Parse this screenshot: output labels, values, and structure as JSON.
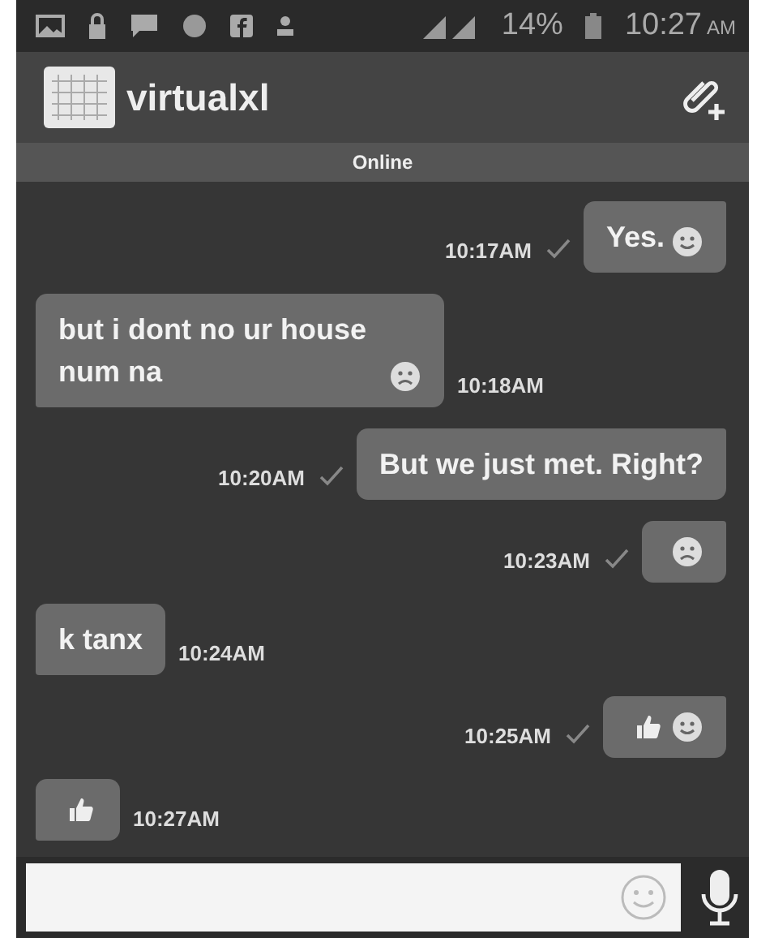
{
  "status_bar": {
    "battery": "14%",
    "time": "10:27",
    "meridiem": "AM"
  },
  "header": {
    "title": "virtualxl",
    "presence": "Online"
  },
  "messages": [
    {
      "outgoing": true,
      "text": "Yes.",
      "emoji": [
        {
          "kind": "smile"
        }
      ],
      "time": "10:17AM",
      "delivered": true
    },
    {
      "outgoing": false,
      "text": "but i dont no ur house num na",
      "emoji": [
        {
          "kind": "sad"
        }
      ],
      "time": "10:18AM"
    },
    {
      "outgoing": true,
      "text": "But we just met. Right?",
      "time": "10:20AM",
      "delivered": true
    },
    {
      "outgoing": true,
      "emoji": [
        {
          "kind": "sad"
        }
      ],
      "time": "10:23AM",
      "delivered": true
    },
    {
      "outgoing": false,
      "text": "k tanx",
      "time": "10:24AM"
    },
    {
      "outgoing": true,
      "emoji": [
        {
          "kind": "thumb"
        },
        {
          "kind": "smile"
        }
      ],
      "time": "10:25AM",
      "delivered": true
    },
    {
      "outgoing": false,
      "emoji": [
        {
          "kind": "thumb"
        }
      ],
      "time": "10:27AM"
    }
  ]
}
